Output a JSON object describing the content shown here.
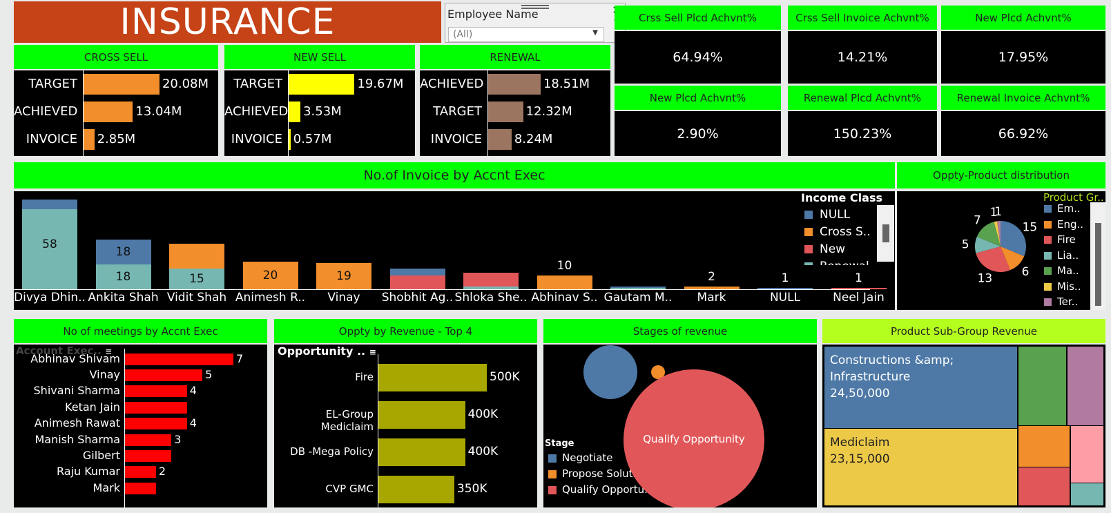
{
  "title": "INSURANCE",
  "filter": {
    "label": "Employee Name",
    "value": "(All)"
  },
  "kpis": [
    {
      "label": "Crss Sell Plcd Achvnt%",
      "value": "64.94%"
    },
    {
      "label": "Crss Sell Invoice Achvnt%",
      "value": "14.21%"
    },
    {
      "label": "New Plcd Achvnt%",
      "value": "17.95%"
    },
    {
      "label": "New Plcd Achvnt%",
      "value": "2.90%"
    },
    {
      "label": "Renewal Plcd Achvnt%",
      "value": "150.23%"
    },
    {
      "label": "Renewal Invoice Achvnt%",
      "value": "66.92%"
    }
  ],
  "chart_data": [
    {
      "type": "bar",
      "title": "CROSS SELL",
      "categories": [
        "TARGET",
        "ACHIEVED",
        "INVOICE"
      ],
      "values": [
        20.08,
        13.04,
        2.85
      ],
      "value_labels": [
        "20.08M",
        "13.04M",
        "2.85M"
      ],
      "color": "#f28e2b",
      "orientation": "horizontal"
    },
    {
      "type": "bar",
      "title": "NEW SELL",
      "categories": [
        "TARGET",
        "ACHIEVED",
        "INVOICE"
      ],
      "values": [
        19.67,
        3.53,
        0.57
      ],
      "value_labels": [
        "19.67M",
        "3.53M",
        "0.57M"
      ],
      "color": "#ffff00",
      "orientation": "horizontal"
    },
    {
      "type": "bar",
      "title": "RENEWAL",
      "categories": [
        "ACHIEVED",
        "TARGET",
        "INVOICE"
      ],
      "values": [
        18.51,
        12.32,
        8.24
      ],
      "value_labels": [
        "18.51M",
        "12.32M",
        "8.24M"
      ],
      "color": "#9c7561",
      "orientation": "horizontal"
    },
    {
      "type": "bar",
      "title": "No.of Invoice by Accnt Exec",
      "stacked": true,
      "categories": [
        "Divya Dhin..",
        "Ankita Shah",
        "Vidit Shah",
        "Animesh R..",
        "Vinay",
        "Shobhit Ag..",
        "Shloka She..",
        "Abhinav S..",
        "Gautam M..",
        "Mark",
        "NULL",
        "Neel Jain"
      ],
      "series": [
        {
          "name": "Renewal",
          "color": "#76b7b2",
          "values": [
            58,
            18,
            15,
            0,
            0,
            0,
            2,
            0,
            1,
            0,
            0,
            0
          ]
        },
        {
          "name": "New",
          "color": "#e15759",
          "values": [
            0,
            0,
            0,
            0,
            0,
            10,
            10,
            0,
            0,
            0,
            0,
            1
          ]
        },
        {
          "name": "Cross S..",
          "color": "#f28e2b",
          "values": [
            0,
            0,
            18,
            20,
            19,
            0,
            0,
            10,
            0,
            2,
            0,
            0
          ]
        },
        {
          "name": "NULL",
          "color": "#4e79a7",
          "values": [
            7,
            18,
            0,
            0,
            0,
            5,
            0,
            0,
            1,
            0,
            1,
            0
          ]
        }
      ],
      "data_labels": [
        {
          "category": "Divya Dhin..",
          "text": "58"
        },
        {
          "category": "Ankita Shah",
          "text": "18",
          "segment": "NULL"
        },
        {
          "category": "Ankita Shah",
          "text": "18",
          "segment": "Renewal"
        },
        {
          "category": "Vidit Shah",
          "text": "15",
          "segment": "Renewal"
        },
        {
          "category": "Animesh R..",
          "text": "20"
        },
        {
          "category": "Vinay",
          "text": "19"
        },
        {
          "category": "Abhinav S..",
          "text": "10"
        },
        {
          "category": "Mark",
          "text": "2"
        },
        {
          "category": "NULL",
          "text": "1"
        },
        {
          "category": "Neel Jain",
          "text": "1"
        }
      ],
      "legend": {
        "title": "Income Class",
        "items": [
          "NULL",
          "Cross S..",
          "New",
          "Renewal"
        ],
        "placement": "top-right"
      }
    },
    {
      "type": "pie",
      "title": "Oppty-Product distribution",
      "slices": [
        {
          "label": "Em..",
          "value": 15,
          "color": "#4e79a7"
        },
        {
          "label": "Eng..",
          "value": 6,
          "color": "#f28e2b"
        },
        {
          "label": "Fire",
          "value": 13,
          "color": "#e15759"
        },
        {
          "label": "Lia..",
          "value": 5,
          "color": "#76b7b2"
        },
        {
          "label": "Ma..",
          "value": 7,
          "color": "#59a14f"
        },
        {
          "label": "Mis..",
          "value": 1,
          "color": "#edc948"
        },
        {
          "label": "Ter..",
          "value": 1,
          "color": "#b07aa1"
        }
      ],
      "legend": {
        "title": "Product Gr..",
        "placement": "right"
      }
    },
    {
      "type": "bar",
      "title": "No of meetings by Accnt Exec",
      "orientation": "horizontal",
      "axis_title": "Account Exec..",
      "categories": [
        "Abhinav Shivam",
        "Vinay",
        "Shivani Sharma",
        "Ketan Jain",
        "Animesh Rawat",
        "Manish Sharma",
        "Gilbert",
        "Raju Kumar",
        "Mark"
      ],
      "values": [
        7,
        5,
        4,
        4,
        4,
        3,
        3,
        2,
        2
      ],
      "value_labels": [
        "7",
        "5",
        "4",
        "",
        "4",
        "3",
        "",
        "2",
        ""
      ],
      "color": "#ff0000"
    },
    {
      "type": "bar",
      "title": "Oppty by Revenue - Top 4",
      "orientation": "horizontal",
      "axis_title": "Opportunity ..",
      "categories": [
        "Fire",
        "EL-Group Mediclaim",
        "DB -Mega Policy",
        "CVP GMC"
      ],
      "values": [
        500000,
        400000,
        400000,
        350000
      ],
      "value_labels": [
        "500K",
        "400K",
        "400K",
        "350K"
      ],
      "color": "#a7a700"
    },
    {
      "type": "scatter",
      "title": "Stages of revenue",
      "bubbles": [
        {
          "stage": "Negotiate",
          "color": "#4e79a7"
        },
        {
          "stage": "Propose Solution",
          "color": "#f28e2b"
        },
        {
          "stage": "Qualify Opportunity",
          "color": "#e15759",
          "label": "Qualify Opportunity"
        }
      ],
      "legend": {
        "title": "Stage",
        "items": [
          "Negotiate",
          "Propose Solution",
          "Qualify Opportu.."
        ]
      }
    },
    {
      "type": "heatmap",
      "title": "Product Sub-Group Revenue",
      "tiles": [
        {
          "label": "Constructions &amp; Infrastructure",
          "value": "24,50,000",
          "color": "#4e79a7"
        },
        {
          "label": "Mediclaim",
          "value": "23,15,000",
          "color": "#edc948"
        },
        {
          "label": "",
          "color": "#59a14f"
        },
        {
          "label": "",
          "color": "#b07aa1"
        },
        {
          "label": "",
          "color": "#f28e2b"
        },
        {
          "label": "",
          "color": "#ff9da7"
        },
        {
          "label": "",
          "color": "#e15759"
        },
        {
          "label": "",
          "color": "#76b7b2"
        }
      ]
    }
  ]
}
